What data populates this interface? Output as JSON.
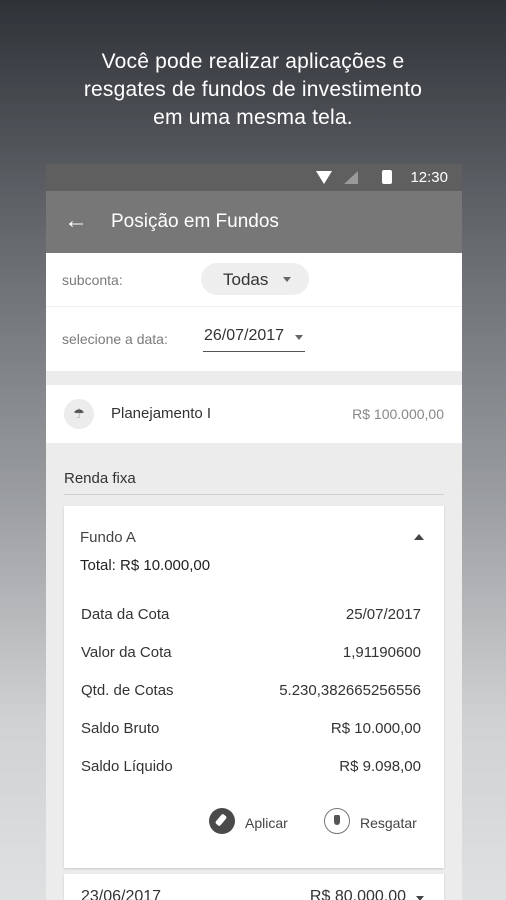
{
  "promo": {
    "line1": "Você pode realizar aplicações e",
    "line2": "resgates de fundos de investimento",
    "line3": "em uma mesma tela."
  },
  "status_bar": {
    "time": "12:30"
  },
  "app_bar": {
    "title": "Posição em Fundos",
    "back_icon": "arrow-left-icon"
  },
  "filters": {
    "subconta_label": "subconta:",
    "subconta_value": "Todas",
    "date_label": "selecione a data:",
    "date_value": "26/07/2017"
  },
  "plan": {
    "name": "Planejamento I",
    "value": "R$ 100.000,00"
  },
  "section": {
    "title": "Renda fixa"
  },
  "fund": {
    "name": "Fundo A",
    "total": "Total: R$ 10.000,00",
    "rows": [
      {
        "label": "Data da Cota",
        "value": "25/07/2017"
      },
      {
        "label": "Valor da Cota",
        "value": "1,91190600"
      },
      {
        "label": "Qtd. de Cotas",
        "value": "5.230,382665256556"
      },
      {
        "label": "Saldo Bruto",
        "value": "R$ 10.000,00"
      },
      {
        "label": "Saldo Líquido",
        "value": "R$ 9.098,00"
      }
    ],
    "actions": {
      "apply": "Aplicar",
      "redeem": "Resgatar"
    }
  },
  "next_item": {
    "date": "23/06/2017",
    "value": "R$ 80.000,00"
  }
}
